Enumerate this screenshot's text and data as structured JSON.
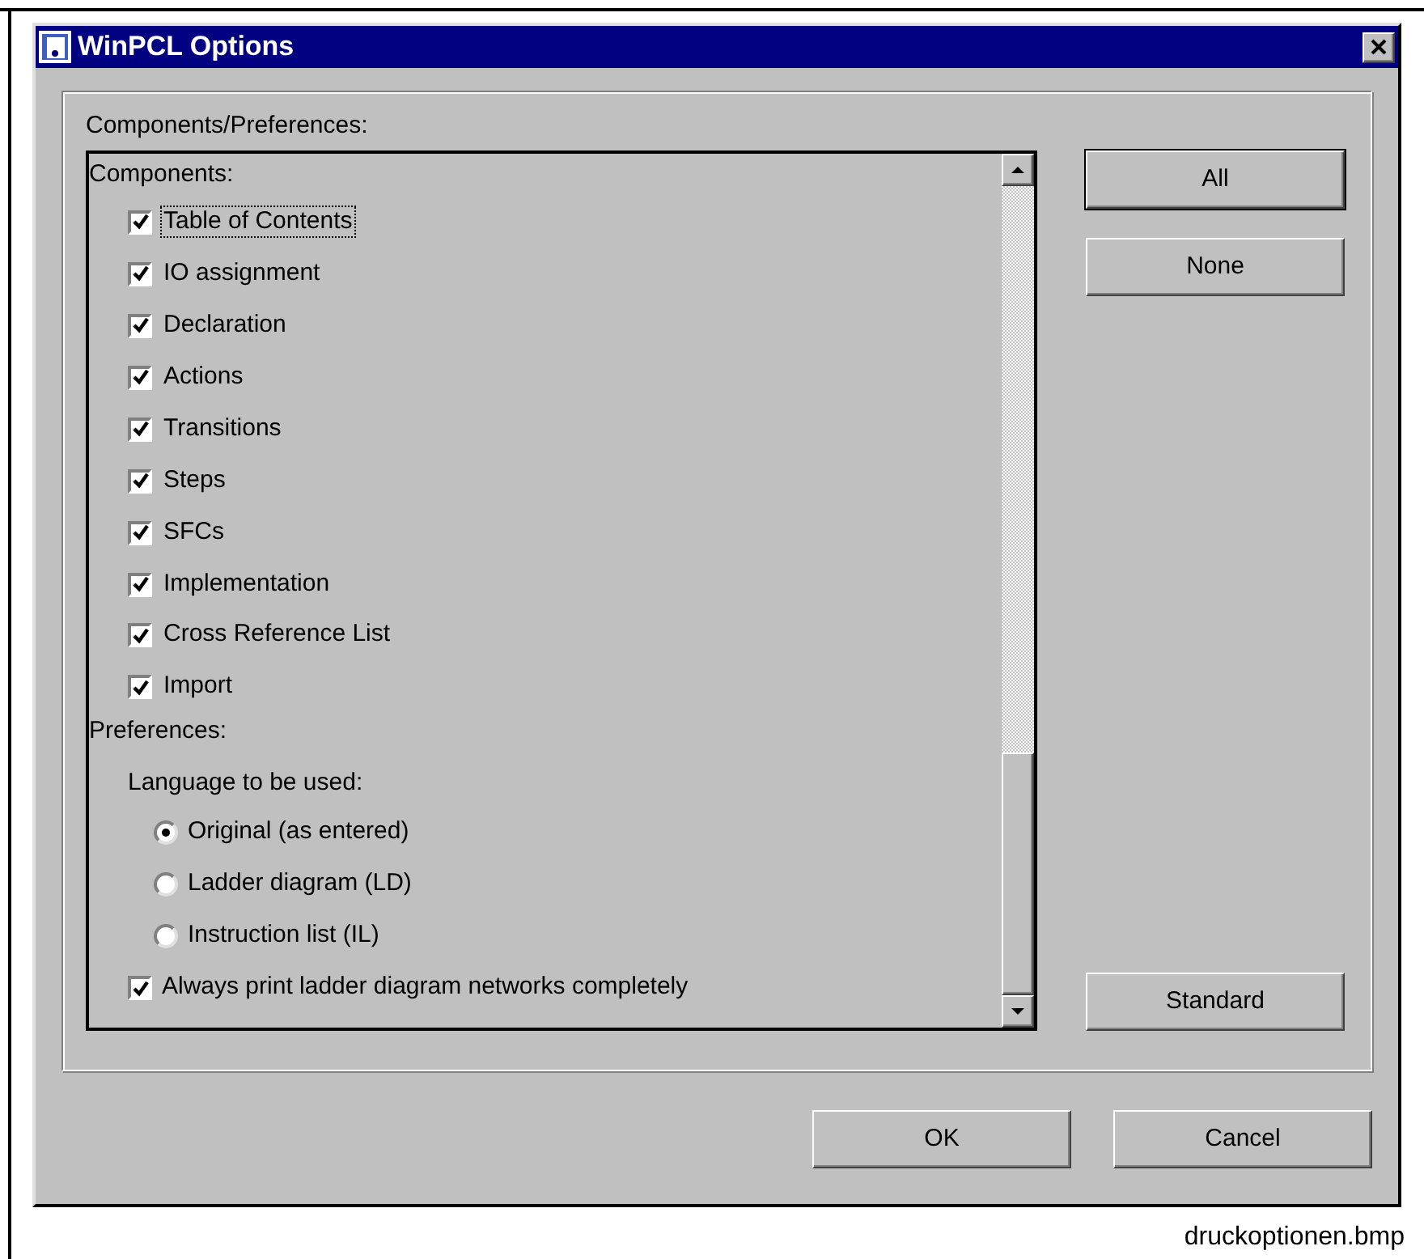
{
  "window": {
    "title": "WinPCL Options"
  },
  "group": {
    "label": "Components/Preferences:"
  },
  "components": {
    "heading": "Components:",
    "items": [
      {
        "label": "Table of Contents",
        "checked": true,
        "focused": true
      },
      {
        "label": "IO assignment",
        "checked": true,
        "focused": false
      },
      {
        "label": "Declaration",
        "checked": true,
        "focused": false
      },
      {
        "label": "Actions",
        "checked": true,
        "focused": false
      },
      {
        "label": "Transitions",
        "checked": true,
        "focused": false
      },
      {
        "label": "Steps",
        "checked": true,
        "focused": false
      },
      {
        "label": "SFCs",
        "checked": true,
        "focused": false
      },
      {
        "label": "Implementation",
        "checked": true,
        "focused": false
      },
      {
        "label": "Cross Reference List",
        "checked": true,
        "focused": false
      },
      {
        "label": "Import",
        "checked": true,
        "focused": false
      }
    ]
  },
  "preferences": {
    "heading": "Preferences:",
    "language_label": "Language to be used:",
    "languages": [
      {
        "label": "Original (as entered)",
        "selected": true
      },
      {
        "label": "Ladder diagram (LD)",
        "selected": false
      },
      {
        "label": "Instruction list (IL)",
        "selected": false
      }
    ],
    "complete_networks": {
      "label": "Always print ladder diagram networks completely",
      "checked": true
    }
  },
  "side_buttons": [
    {
      "label": "All",
      "default": true
    },
    {
      "label": "None",
      "default": false
    }
  ],
  "standard_button": "Standard",
  "buttons": [
    "OK",
    "Cancel"
  ],
  "caption": "druckoptionen.bmp"
}
